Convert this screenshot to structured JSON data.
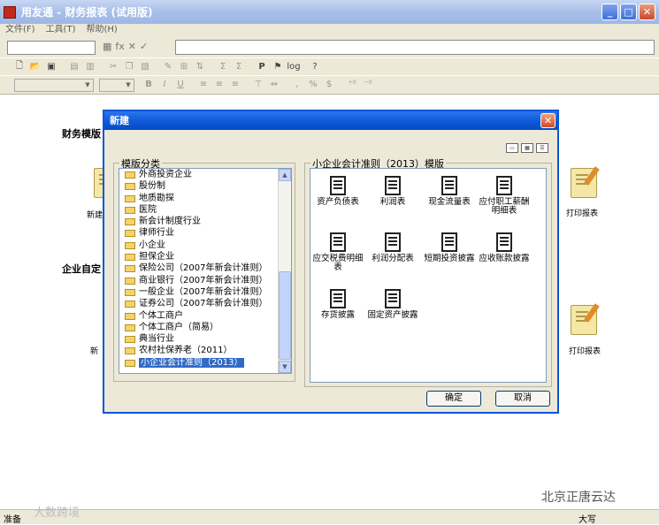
{
  "window": {
    "title": "用友通 - 财务报表 (试用版)",
    "controls": {
      "minimize": "_",
      "maximize": "□",
      "close": "✕"
    }
  },
  "menu": [
    "文件(F)",
    "工具(T)",
    "帮助(H)"
  ],
  "formula_bar_icons": [
    "▦",
    "fx",
    "✕",
    "✓"
  ],
  "toolbar_icons_row1": [
    "new",
    "open",
    "save",
    "print-preview",
    "print",
    "cut",
    "copy",
    "paste",
    "format-painter",
    "insert",
    "sort",
    "sum",
    "sum-alt",
    "P",
    "tag",
    "log",
    "help"
  ],
  "toolbar_row2": {
    "bold": "B",
    "italic": "I",
    "underline": "U",
    "comma": ",",
    "percent": "%",
    "currency": "$"
  },
  "background": {
    "section1": "财务模版",
    "section2": "企业自定",
    "left_label1": "新建",
    "left_label2": "新",
    "right_label1": "打印报表",
    "right_label2": "打印报表"
  },
  "dialog": {
    "title": "新建",
    "close": "✕",
    "category_caption": "模版分类",
    "categories": [
      "外商投资企业",
      "股份制",
      "地质勘探",
      "医院",
      "新会计制度行业",
      "律师行业",
      "小企业",
      "担保企业",
      "保险公司（2007年新会计准则）",
      "商业银行（2007年新会计准则）",
      "一般企业（2007年新会计准则）",
      "证券公司（2007年新会计准则）",
      "个体工商户",
      "个体工商户（简易）",
      "典当行业",
      "农村社保养老（2011）",
      "小企业会计准则（2013）"
    ],
    "selected_category": "小企业会计准则（2013）",
    "templates_caption": "小企业会计准则（2013）模版",
    "templates": [
      "资产负债表",
      "利润表",
      "现金流量表",
      "应付职工薪酬明细表",
      "应交税费明细表",
      "利润分配表",
      "短期投资披露",
      "应收账款披露",
      "存货披露",
      "固定资产披露"
    ],
    "ok": "确定",
    "cancel": "取消"
  },
  "status": {
    "left": "准备",
    "right": "大写"
  },
  "watermark": {
    "left": "大数跨境",
    "right": "北京正唐云达"
  }
}
